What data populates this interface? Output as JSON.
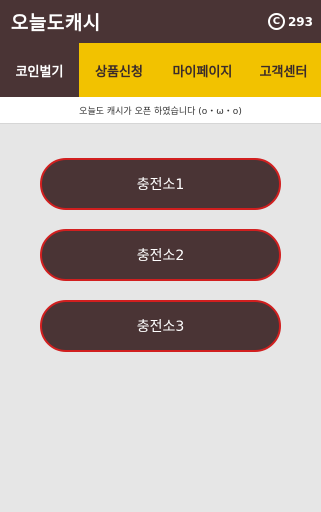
{
  "header": {
    "title": "오늘도캐시",
    "coin_icon": "copyright-icon",
    "coin_symbol": "C",
    "coin_count": "293"
  },
  "tabs": [
    {
      "label": "코인벌기",
      "active": true
    },
    {
      "label": "상품신청",
      "active": false
    },
    {
      "label": "마이페이지",
      "active": false
    },
    {
      "label": "고객센터",
      "active": false
    }
  ],
  "notice": "오늘도 캐시가 오픈 하였습니다 (o・ω・o)",
  "stations": [
    {
      "label": "충전소1"
    },
    {
      "label": "충전소2"
    },
    {
      "label": "충전소3"
    }
  ],
  "colors": {
    "header_bg": "#4a3435",
    "tab_bar_bg": "#f2c200",
    "button_border": "#d11f1f",
    "page_bg": "#e6e6e6"
  }
}
